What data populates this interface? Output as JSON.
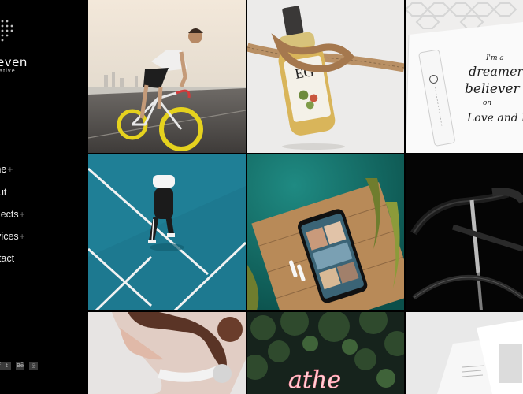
{
  "brand": {
    "name": "even",
    "tagline": "ative"
  },
  "nav": {
    "items": [
      {
        "label": "me",
        "plus": "+"
      },
      {
        "label": "out",
        "plus": ""
      },
      {
        "label": "ojects",
        "plus": "+"
      },
      {
        "label": "rvices",
        "plus": "+"
      },
      {
        "label": "ntact",
        "plus": ""
      }
    ]
  },
  "social": [
    {
      "icon": "facebook-icon",
      "glyph": "f"
    },
    {
      "icon": "twitter-icon",
      "glyph": "t"
    },
    {
      "icon": "behance-icon",
      "glyph": "Bē"
    },
    {
      "icon": "instagram-icon",
      "glyph": "◎"
    }
  ],
  "gallery": {
    "bottle_label": "EG",
    "journal_line1": "I'm a",
    "journal_line2": "dreamer",
    "journal_line3": "believer",
    "journal_line4": "on",
    "journal_line5": "Love and Me",
    "neon_text": "athe"
  }
}
